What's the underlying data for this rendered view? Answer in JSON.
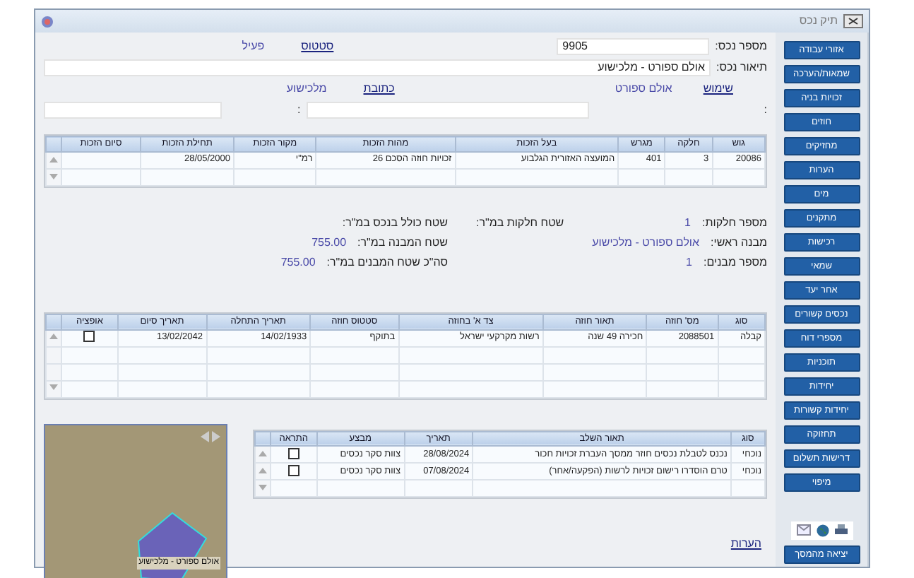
{
  "window": {
    "title": "תיק נכס"
  },
  "sidebar": {
    "buttons": [
      "אזורי עבודה",
      "שמאות/הערכה",
      "זכויות בניה",
      "חוזים",
      "מחזיקים",
      "הערות",
      "מים",
      "מתקנים",
      "רכישות",
      "שמאי",
      "אחר יעד",
      "נכסים קשורים",
      "מספרי דוח",
      "תוכניות",
      "יחידות",
      "יחידות קשורות",
      "תחזוקה",
      "דרישות תשלום",
      "מיפוי"
    ],
    "exit_button": "יציאה מהמסך"
  },
  "property_number": {
    "label": "מספר נכס:",
    "value": "9905"
  },
  "status": {
    "label": "סטטוס",
    "value": "פעיל"
  },
  "description": {
    "label": "תיאור נכס:",
    "value": "אולם ספורט - מלכישוע"
  },
  "usage": {
    "label": "שימוש",
    "value": "אולם ספורט"
  },
  "address": {
    "label": "כתובת",
    "value": "מלכישוע"
  },
  "extra_labels": [
    ":",
    ":"
  ],
  "rights_table": {
    "columns": [
      "גוש",
      "חלקה",
      "מגרש",
      "בעל הזכות",
      "מהות הזכות",
      "מקור הזכות",
      "תחילת הזכות",
      "סיום הזכות"
    ],
    "rows": [
      {
        "cells": [
          "20086",
          "3",
          "401",
          "המועצה האזורית הגלבוע",
          "זכויות חוזה הסכם 26",
          "רמ\"י",
          "28/05/2000",
          null
        ]
      }
    ]
  },
  "info_right": [
    {
      "label": "מספר חלקות:",
      "value": "1"
    },
    {
      "label": "מבנה ראשי:",
      "value": "אולם ספורט - מלכישוע"
    },
    {
      "label": "מספר מבנים:",
      "value": "1"
    }
  ],
  "info_middle": [
    {
      "label": "שטח חלקות במ\"ר:"
    }
  ],
  "info_left": [
    {
      "label": "שטח כולל בנכס במ\"ר:"
    },
    {
      "label": "שטח המבנה במ\"ר:",
      "value": "755.00"
    },
    {
      "label": "סה\"כ שטח המבנים במ\"ר:",
      "value": "755.00"
    }
  ],
  "contracts_table": {
    "columns": [
      "סוג",
      "מס' חוזה",
      "תאור חוזה",
      "צד א' בחוזה",
      "סטטוס חוזה",
      "תאריך התחלה",
      "תאריך סיום",
      "אופציה"
    ],
    "rows": [
      {
        "cells": [
          "קבלה",
          "2088501",
          "חכירה 49 שנה",
          "רשות מקרקעי ישראל",
          "בתוקף",
          "14/02/1933",
          "13/02/2042"
        ],
        "option": false
      }
    ]
  },
  "map": {
    "caption": "אולם ספורט - מלכישוע"
  },
  "stages_table": {
    "columns": [
      "סוג",
      "תאור השלב",
      "תאריך",
      "מבצע",
      "התראה"
    ],
    "rows": [
      {
        "cells": [
          "נוכחי",
          "נכנס לטבלת נכסים חוזר ממסך העברת זכויות חכור",
          "28/08/2024",
          "צוות סקר נכסים"
        ],
        "alert": false
      },
      {
        "cells": [
          "נוכחי",
          "טרם הוסדרו רישום זכויות לרשות (הפקעה/אחר)",
          "07/08/2024",
          "צוות סקר נכסים"
        ],
        "alert": false
      }
    ]
  },
  "notes_link": "הערות"
}
